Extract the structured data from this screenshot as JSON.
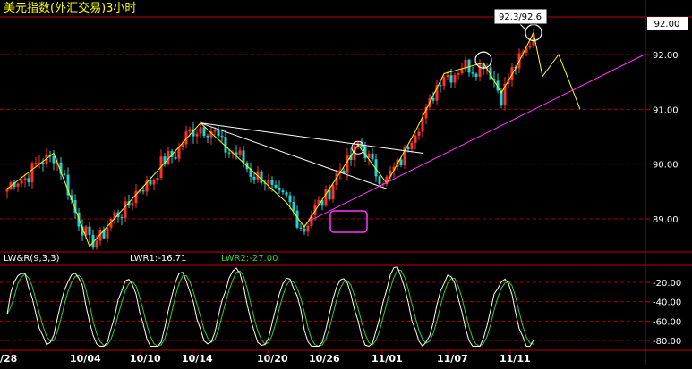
{
  "colors": {
    "background": "#000000",
    "frame": "#c00000",
    "grid": "#a00000",
    "candle_up": "#ff3030",
    "candle_down": "#22d3d3",
    "trend_yellow": "#ffff00",
    "trend_white": "#ffffff",
    "trend_magenta": "#ff33ff",
    "lwr1_line": "#ffffff",
    "lwr2_line": "#33cc33",
    "title_text": "#ffff00",
    "axis_text": "#ffffff"
  },
  "chart_data": [
    {
      "type": "candlestick",
      "title": "美元指数(外汇交易)3小时",
      "y_tick_labels": [
        "92.00",
        "91.00",
        "90.00",
        "89.00"
      ],
      "y_ticks": [
        92.0,
        91.0,
        90.0,
        89.0
      ],
      "ylim": [
        88.55,
        92.7
      ],
      "current_price_label": "92.00",
      "current_price": 92.0,
      "x_tick_labels": [
        "/28",
        "10/04",
        "10/10",
        "10/14",
        "10/20",
        "10/26",
        "11/01",
        "11/07",
        "11/11"
      ],
      "annotations": [
        {
          "text": "92.3/92.6"
        }
      ],
      "swing_points": [
        {
          "bar": 0,
          "price": 89.55
        },
        {
          "bar": 13,
          "price": 90.2
        },
        {
          "bar": 23,
          "price": 88.5
        },
        {
          "bar": 54,
          "price": 90.75
        },
        {
          "bar": 78,
          "price": 89.3
        },
        {
          "bar": 83,
          "price": 88.85
        },
        {
          "bar": 98,
          "price": 90.35
        },
        {
          "bar": 106,
          "price": 89.65
        },
        {
          "bar": 114,
          "price": 90.6
        },
        {
          "bar": 122,
          "price": 91.65
        },
        {
          "bar": 133,
          "price": 91.85
        },
        {
          "bar": 138,
          "price": 91.3
        },
        {
          "bar": 142,
          "price": 91.75
        },
        {
          "bar": 147,
          "price": 92.4
        }
      ],
      "projection": [
        92.4,
        91.6,
        92.0,
        91.0
      ],
      "trend_lines": [
        {
          "color": "white",
          "from": [
            54,
            90.75
          ],
          "to": [
            106,
            89.55
          ]
        },
        {
          "color": "white",
          "from": [
            54,
            90.75
          ],
          "to": [
            116,
            90.2
          ]
        },
        {
          "color": "magenta",
          "from": [
            84,
            88.95
          ],
          "to": [
            178,
            92.0
          ]
        }
      ]
    },
    {
      "type": "line",
      "title": "LW&R(9,3,3)",
      "series": [
        {
          "name": "LWR1",
          "value": -16.71
        },
        {
          "name": "LWR2",
          "value": -27.0
        }
      ],
      "y_tick_labels": [
        "-20.00",
        "-40.00",
        "-60.00",
        "-80.00"
      ],
      "y_ticks": [
        -20,
        -40,
        -60,
        -80
      ],
      "ylim": [
        -88,
        0
      ]
    }
  ],
  "labels": {
    "lwr_title": "LW&R(9,3,3)",
    "lwr1": "LWR1:-16.71",
    "lwr2": "LWR2:-27.00"
  }
}
